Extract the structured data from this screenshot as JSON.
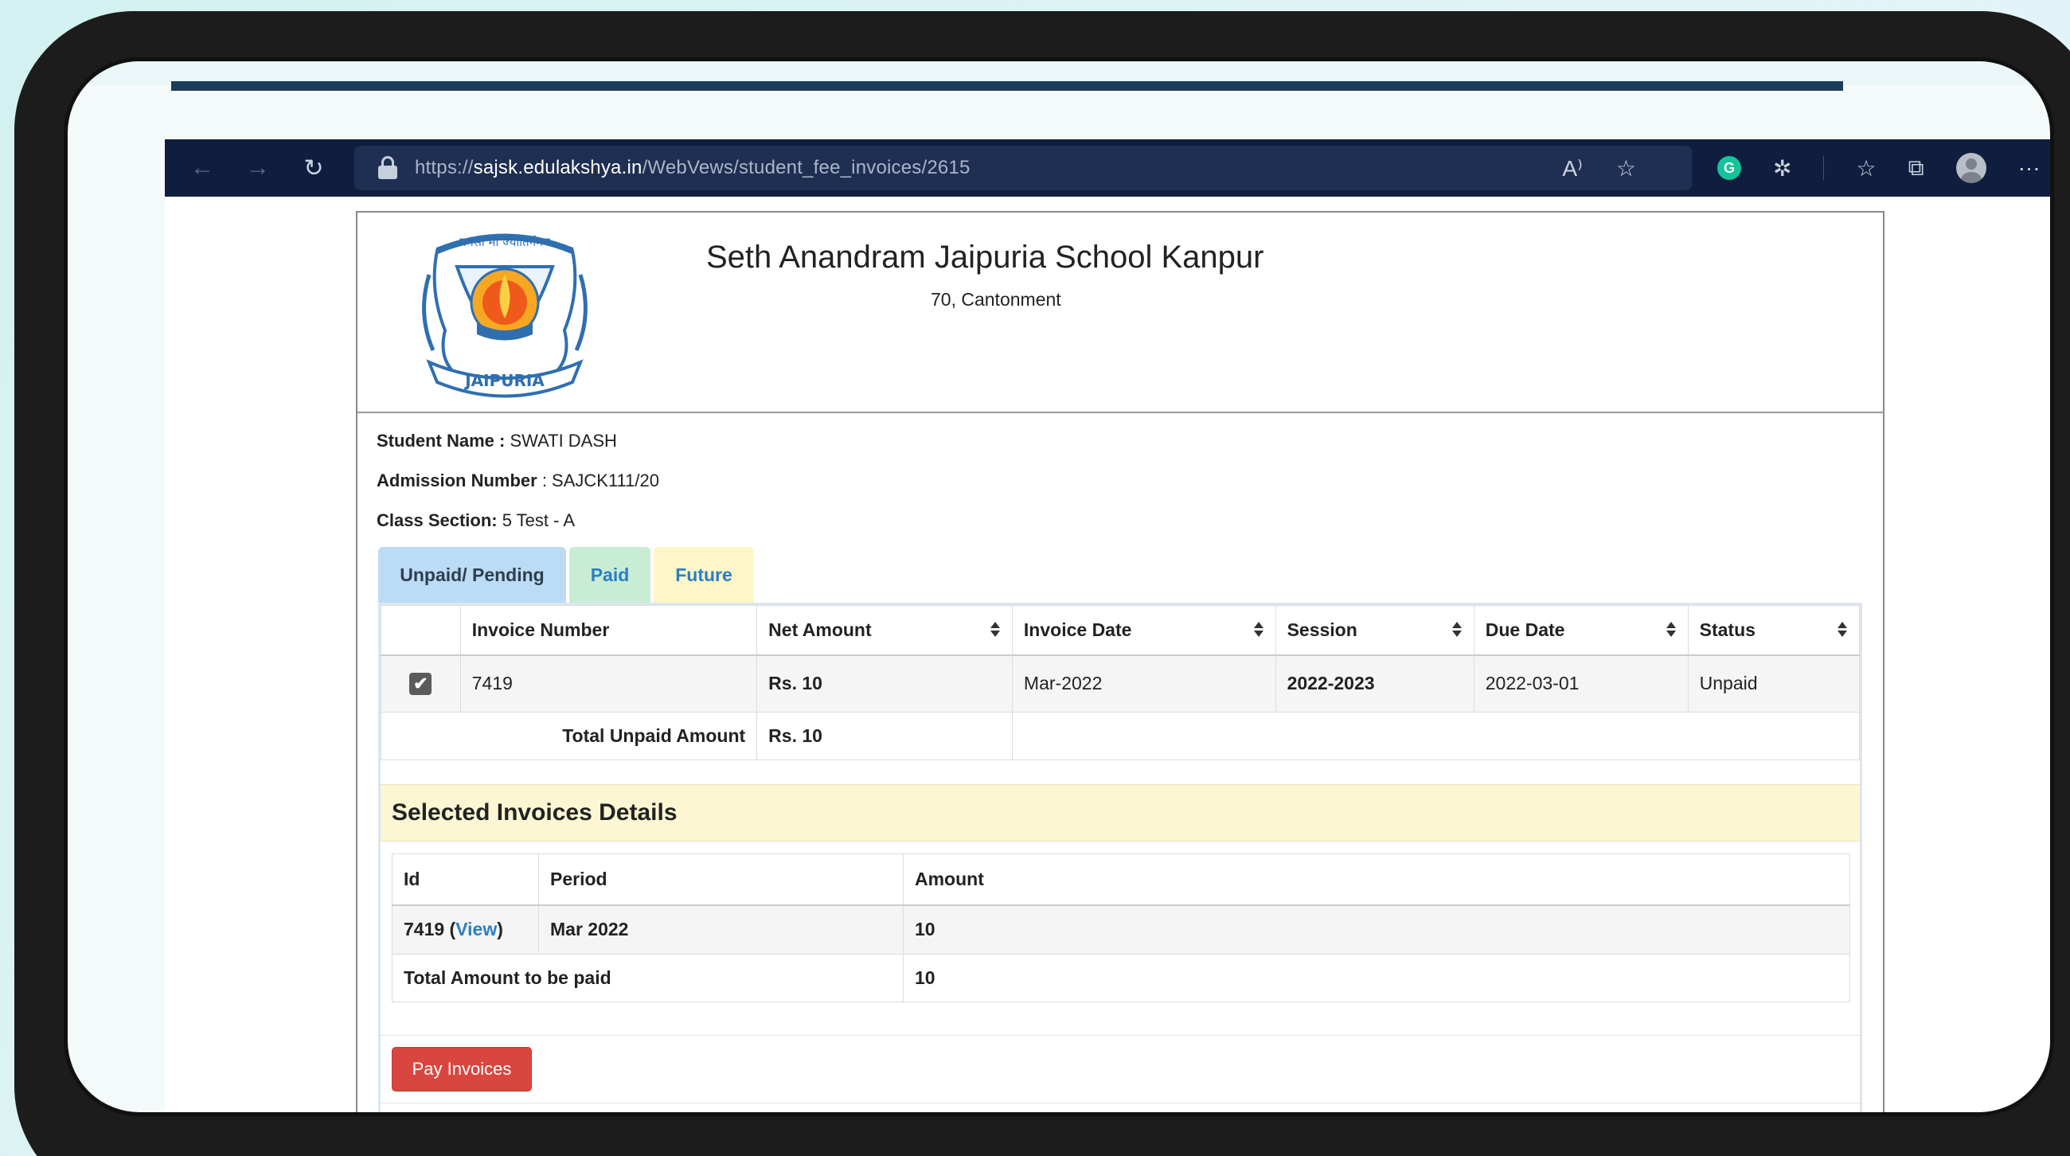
{
  "browser": {
    "url_prefix": "https://",
    "url_host": "sajsk.edulakshya.in",
    "url_path": "/WebVews/student_fee_invoices/2615",
    "icons": [
      "back-arrow-icon",
      "forward-arrow-icon",
      "reload-icon",
      "lock-icon",
      "read-aloud-icon",
      "add-favorite-icon",
      "grammarly-icon",
      "extensions-icon",
      "favorites-icon",
      "collections-icon",
      "profile-avatar-icon",
      "more-menu-icon"
    ],
    "glyphs": {
      "back": "←",
      "forward": "→",
      "reload": "↻",
      "read_aloud": "A⁾",
      "add_favorite": "☆",
      "grammarly": "G",
      "extensions": "✲",
      "favorites": "☆",
      "collections": "⧉",
      "more": "···"
    }
  },
  "school": {
    "name": "Seth Anandram Jaipuria School Kanpur",
    "address": "70, Cantonment",
    "logo_text_top": "तमसो मा ज्योतिर्गमय",
    "logo_text_banner": "JAIPURIA"
  },
  "student": {
    "name_label": "Student Name :",
    "name_value": " SWATI DASH",
    "admission_label": "Admission Number",
    "admission_value": " : SAJCK111/20",
    "class_label": "Class Section:",
    "class_value": " 5 Test - A"
  },
  "tabs": {
    "unpaid": "Unpaid/ Pending",
    "paid": "Paid",
    "future": "Future"
  },
  "invoice_table": {
    "headers": [
      "",
      "Invoice Number",
      "Net Amount",
      "Invoice Date",
      "Session",
      "Due Date",
      "Status"
    ],
    "row": {
      "checked": "✔",
      "invoice_number": "7419",
      "net_amount": "Rs. 10",
      "invoice_date": "Mar-2022",
      "session": "2022-2023",
      "due_date": "2022-03-01",
      "status": "Unpaid"
    },
    "total_label": "Total Unpaid Amount",
    "total_value": "Rs. 10"
  },
  "selected": {
    "title": "Selected Invoices Details",
    "headers": [
      "Id",
      "Period",
      "Amount"
    ],
    "row": {
      "id": "7419 (",
      "view_link": "View",
      "id_close": ")",
      "period": "Mar 2022",
      "amount": "10"
    },
    "total_label": "Total Amount to be paid",
    "total_value": "10"
  },
  "actions": {
    "pay_button": "Pay Invoices"
  },
  "colors": {
    "browser_bar": "#0f1e3f",
    "session_red": "#e0262d",
    "pay_button": "#d9463f",
    "tab_unpaid": "#bcdcf5",
    "tab_paid": "#c8ecd4",
    "tab_future": "#fdf6c6",
    "link_blue": "#2a7fc4"
  }
}
